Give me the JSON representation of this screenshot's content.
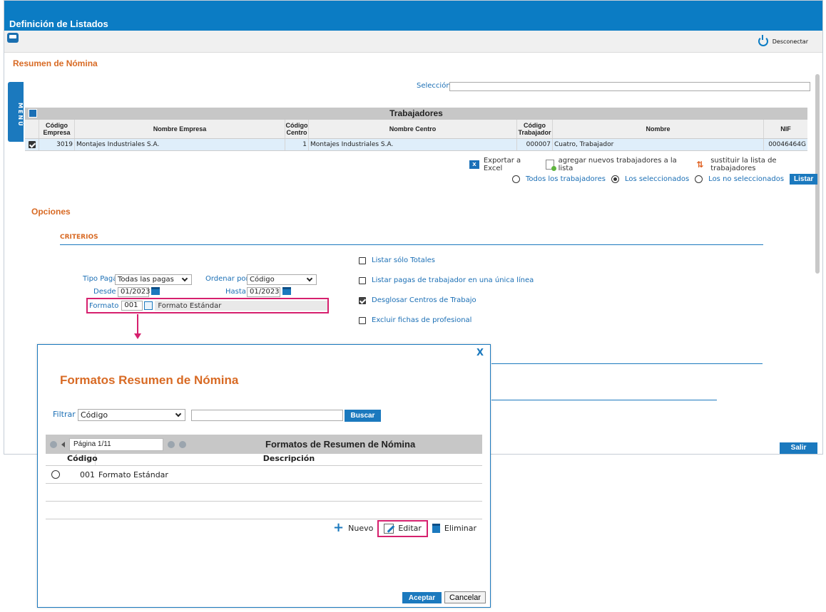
{
  "window": {
    "title": "Definición de Listados"
  },
  "toolbar": {
    "disconnect_label": "Desconectar"
  },
  "page": {
    "section_title": "Resumen de Nómina",
    "menu_label": "MENÚ"
  },
  "selection": {
    "label": "Selección",
    "value": ""
  },
  "workers": {
    "title": "Trabajadores",
    "headers": {
      "codigo_empresa": "Código Empresa",
      "nombre_empresa": "Nombre Empresa",
      "codigo_centro": "Código Centro",
      "nombre_centro": "Nombre Centro",
      "codigo_trabajador": "Código Trabajador",
      "nombre": "Nombre",
      "nif": "NIF"
    },
    "rows": [
      {
        "codigo_empresa": "3019",
        "nombre_empresa": "Montajes Industriales S.A.",
        "codigo_centro": "1",
        "nombre_centro": "Montajes Industriales S.A.",
        "codigo_trabajador": "000007",
        "nombre": "Cuatro, Trabajador",
        "nif": "00046464G"
      }
    ],
    "actions": {
      "export": "Exportar a Excel",
      "add": "agregar nuevos trabajadores a la lista",
      "replace": "sustituir la lista de trabajadores"
    },
    "filter": {
      "all": "Todos los trabajadores",
      "selected": "Los seleccionados",
      "not_selected": "Los no seleccionados",
      "list_button": "Listar"
    }
  },
  "options": {
    "title": "Opciones",
    "criteria_title": "CRITERIOS",
    "tipo_paga_label": "Tipo Paga",
    "tipo_paga_value": "Todas las pagas",
    "ordenar_label": "Ordenar por",
    "ordenar_value": "Código",
    "desde_label": "Desde",
    "desde_value": "01/2023",
    "hasta_label": "Hasta",
    "hasta_value": "01/2023",
    "formato_label": "Formato",
    "formato_code": "001",
    "formato_name": "Formato Estándar",
    "checks": [
      {
        "label": "Listar sólo Totales",
        "checked": false
      },
      {
        "label": "Listar pagas de trabajador en una única línea",
        "checked": false
      },
      {
        "label": "Desglosar Centros de Trabajo",
        "checked": true
      },
      {
        "label": "Excluir fichas de profesional",
        "checked": false
      }
    ]
  },
  "exit_button": "Salir",
  "modal": {
    "close": "X",
    "title": "Formatos Resumen de Nómina",
    "filter_label": "Filtrar",
    "filter_value": "Código",
    "search_button": "Buscar",
    "table_title": "Formatos de Resumen de Nómina",
    "pager": "Página 1/11",
    "headers": {
      "code": "Código",
      "description": "Descripción"
    },
    "rows": [
      {
        "code": "001",
        "description": "Formato Estándar"
      }
    ],
    "new_label": "Nuevo",
    "edit_label": "Editar",
    "delete_label": "Eliminar",
    "accept": "Aceptar",
    "cancel": "Cancelar"
  },
  "colors": {
    "primary_blue": "#0b7cc4",
    "accent_orange": "#d86a24",
    "highlight_pink": "#d6206e"
  }
}
